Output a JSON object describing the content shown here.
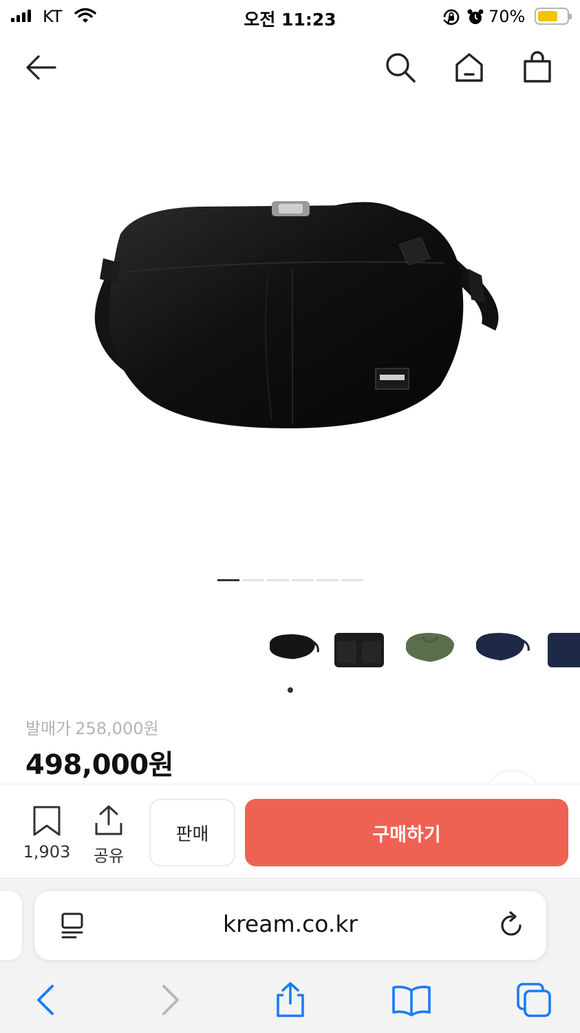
{
  "status_bar": {
    "carrier": "KT",
    "time": "오전 11:23",
    "battery_percent": "70%",
    "battery_level": 0.7,
    "battery_color": "#f5c400"
  },
  "top_nav": {
    "icons": [
      "back-arrow-icon",
      "search-icon",
      "home-icon",
      "shopping-bag-icon"
    ]
  },
  "product": {
    "image_count": 6,
    "active_image_index": 0,
    "thumbnails": [
      {
        "color": "#151515",
        "icon": "black-round-bag"
      },
      {
        "color": "#1c1c1c",
        "icon": "black-square-bag"
      },
      {
        "color": "#5b6e4b",
        "icon": "green-round-bag"
      },
      {
        "color": "#1e2a45",
        "icon": "navy-round-bag"
      },
      {
        "color": "#1e2a45",
        "icon": "navy-square-bag"
      }
    ]
  },
  "price": {
    "release_label": "발매가",
    "release_value": "258,000원",
    "current": "498,000원"
  },
  "actions": {
    "wish_count": "1,903",
    "share_label": "공유",
    "sell_label": "판매",
    "buy_label": "구매하기",
    "buy_color": "#ef6253"
  },
  "browser": {
    "url": "kream.co.kr",
    "accent": "#1a7cf5"
  }
}
